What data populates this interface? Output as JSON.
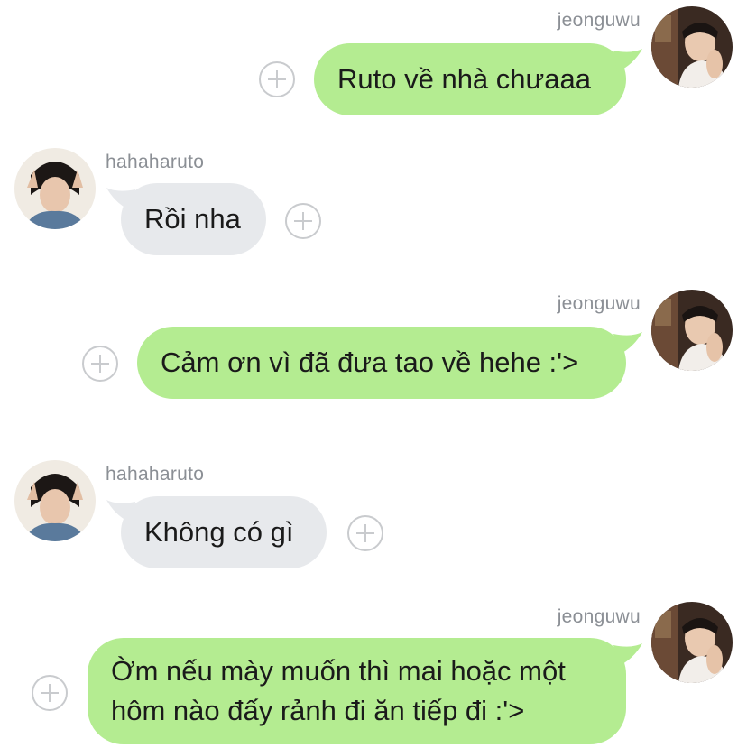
{
  "messages": [
    {
      "sender": "jeonguwu",
      "direction": "outgoing",
      "text": "Ruto về nhà chưaaa"
    },
    {
      "sender": "hahaharuto",
      "direction": "incoming",
      "text": "Rồi nha"
    },
    {
      "sender": "jeonguwu",
      "direction": "outgoing",
      "text": "Cảm ơn vì đã đưa tao về hehe :'>"
    },
    {
      "sender": "hahaharuto",
      "direction": "incoming",
      "text": "Không có gì"
    },
    {
      "sender": "jeonguwu",
      "direction": "outgoing",
      "text": "Ờm nếu mày muốn thì mai hoặc một hôm nào đấy rảnh đi ăn tiếp đi :'>"
    }
  ],
  "icons": {
    "add_reaction": "plus-circle-icon",
    "avatar_outgoing": "jeonguwu-avatar",
    "avatar_incoming": "hahaharuto-avatar"
  },
  "colors": {
    "outgoing_bubble": "#b4ec91",
    "incoming_bubble": "#e7e9ec",
    "sender_name": "#8b8f95",
    "plus_icon": "#c9cbce"
  }
}
